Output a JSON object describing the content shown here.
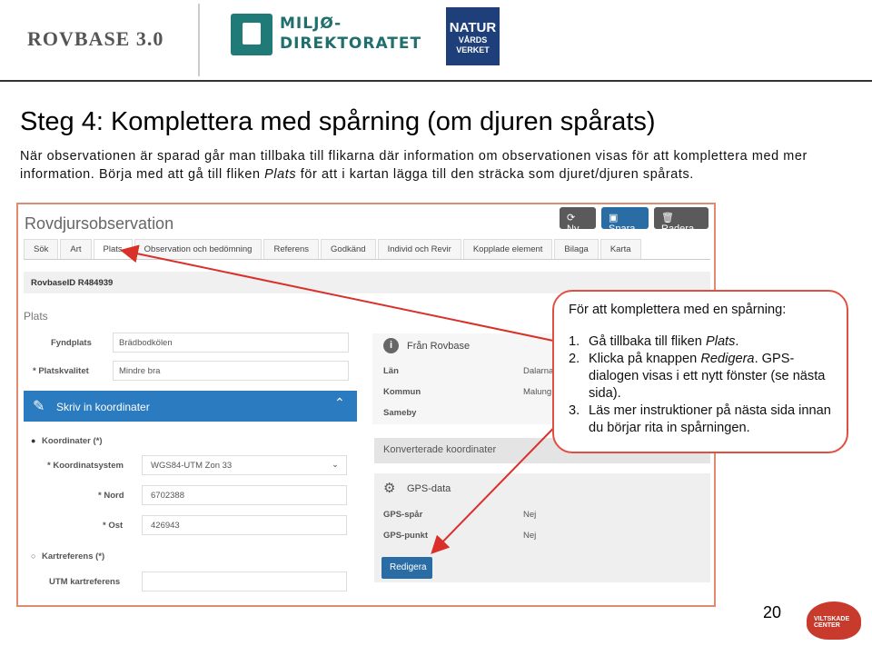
{
  "header": {
    "rovbase_logo": "ROVBASE 3.0",
    "miljo_line1": "MILJØ-",
    "miljo_line2": "DIREKTORATET",
    "natur_line1": "NATUR",
    "natur_line2": "VÅRDS",
    "natur_line3": "VERKET"
  },
  "slide": {
    "title": "Steg 4: Komplettera med spårning (om djuren spårats)",
    "intro_1": "När observationen är sparad går man tillbaka till flikarna där information om observationen visas för att komplettera med mer information. Börja med att gå till fliken ",
    "intro_em": "Plats",
    "intro_2": " för att i kartan lägga till den sträcka som djuret/djuren spårats.",
    "page_number": "20"
  },
  "app": {
    "title": "Rovdjursobservation",
    "buttons": {
      "ny": "Ny",
      "spara": "Spara",
      "radera": "Radera"
    },
    "tabs": [
      "Sök",
      "Art",
      "Plats",
      "Observation och bedömning",
      "Referens",
      "Godkänd",
      "Individ och Revir",
      "Kopplade element",
      "Bilaga",
      "Karta"
    ],
    "rovbase_id": "RovbaseID R484939",
    "section_title": "Plats",
    "fyndplats_label": "Fyndplats",
    "fyndplats_value": "Brädbodkölen",
    "platskvalitet_label": "* Platskvalitet",
    "platskvalitet_value": "Mindre bra",
    "kord_bar": "Skriv in koordinater",
    "koordinater_label": "Koordinater (*)",
    "koordsys_label": "* Koordinatsystem",
    "koordsys_value": "WGS84-UTM Zon 33",
    "nord_label": "* Nord",
    "nord_value": "6702388",
    "ost_label": "* Ost",
    "ost_value": "426943",
    "kartref_label": "Kartreferens (*)",
    "utm_label": "UTM kartreferens",
    "fran_rovbase": "Från Rovbase",
    "lan_label": "Län",
    "lan_value": "Dalarna",
    "kommun_label": "Kommun",
    "kommun_value": "Malung",
    "sameby_label": "Sameby",
    "konverterade": "Konverterade koordinater",
    "gps_title": "GPS-data",
    "gps_spar_label": "GPS-spår",
    "gps_spar_value": "Nej",
    "gps_punkt_label": "GPS-punkt",
    "gps_punkt_value": "Nej",
    "redigera": "Redigera"
  },
  "callout": {
    "title": "För att komplettera med en spårning:",
    "s1_num": "1.",
    "s1_a": "Gå tillbaka till fliken ",
    "s1_em": "Plats",
    "s1_b": ".",
    "s2_num": "2.",
    "s2_a": "Klicka på knappen ",
    "s2_em": "Redigera",
    "s2_b": ". GPS-dialogen visas i ett nytt fönster (se nästa sida).",
    "s3_num": "3.",
    "s3_a": "Läs mer instruktioner på nästa sida innan du börjar rita in spårningen."
  },
  "footer_logo": "VILTSKADE CENTER",
  "colors": {
    "accent_blue": "#2a7bbf",
    "callout_border": "#e05040",
    "arrow": "#d9302a"
  }
}
